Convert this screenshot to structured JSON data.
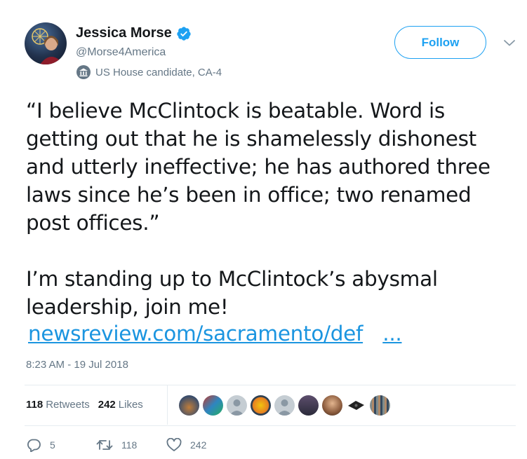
{
  "user": {
    "name": "Jessica Morse",
    "handle": "@Morse4America",
    "label": "US House candidate, CA-4"
  },
  "follow_label": "Follow",
  "tweet": {
    "text": "“I believe McClintock is beatable. Word is getting out that he is shamelessly dishonest and utterly ineffective; he has authored three laws since he’s been in office; two renamed post offices.”\n\nI’m standing up to McClintock’s abysmal leadership, join me!",
    "link": "newsreview.com/sacramento/def",
    "link_ellipsis": "...",
    "timestamp": "8:23 AM - 19 Jul 2018"
  },
  "stats": {
    "retweets_count": "118",
    "retweets_label": "Retweets",
    "likes_count": "242",
    "likes_label": "Likes"
  },
  "actions": {
    "replies": "5",
    "retweets": "118",
    "likes": "242"
  },
  "colors": {
    "accent": "#1da1f2",
    "link": "#1b95e0",
    "muted": "#657786",
    "verified": "#1da1f2"
  },
  "icons": [
    "verified-badge-icon",
    "government-label-icon",
    "chevron-down-icon",
    "reply-icon",
    "retweet-icon",
    "like-icon"
  ]
}
